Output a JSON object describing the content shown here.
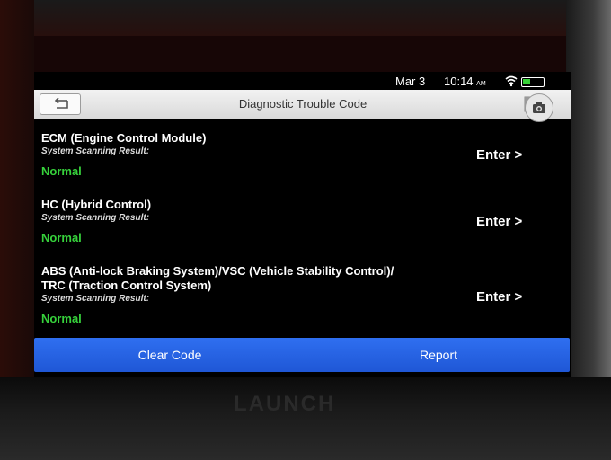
{
  "status": {
    "date": "Mar 3",
    "time": "10:14",
    "ampm": "AM"
  },
  "header": {
    "title": "Diagnostic Trouble Code"
  },
  "modules": [
    {
      "name": "ECM (Engine Control Module)",
      "scan_label": "System Scanning Result:",
      "result": "Normal",
      "action": "Enter >"
    },
    {
      "name": "HC (Hybrid Control)",
      "scan_label": "System Scanning Result:",
      "result": "Normal",
      "action": "Enter >"
    },
    {
      "name_line1": "ABS (Anti-lock Braking System)/VSC (Vehicle Stability Control)/",
      "name_line2": "TRC (Traction Control System)",
      "scan_label": "System Scanning Result:",
      "result": "Normal",
      "action": "Enter >"
    }
  ],
  "actions": {
    "clear": "Clear Code",
    "report": "Report"
  },
  "device": {
    "brand": "LAUNCH"
  },
  "colors": {
    "result_green": "#36d13b",
    "action_blue": "#2563eb"
  }
}
